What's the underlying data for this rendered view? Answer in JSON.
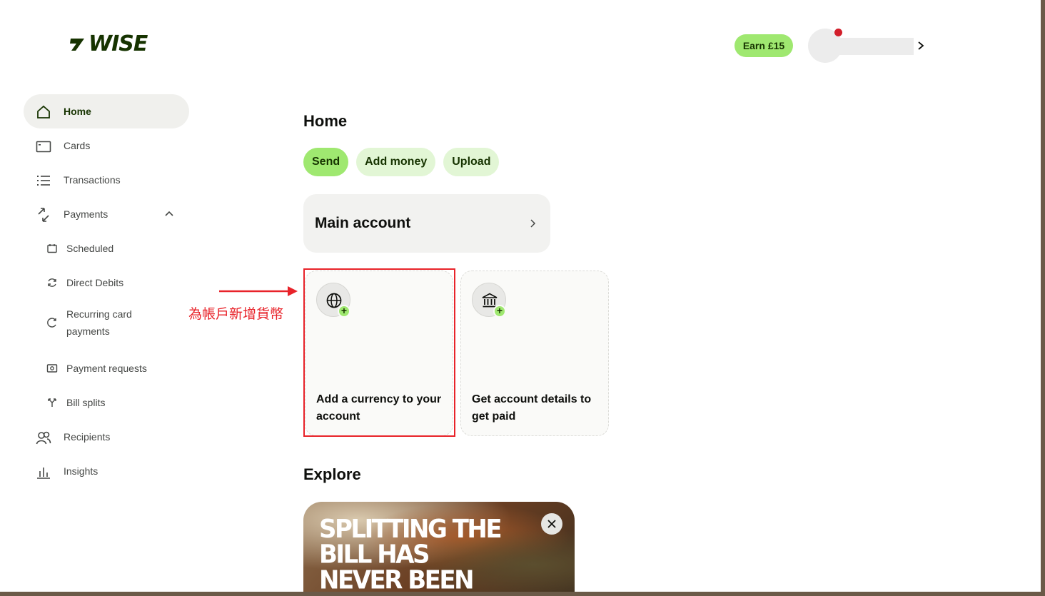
{
  "brand": {
    "logo_text": "WISE",
    "accent": "#9fe870",
    "dark": "#163300"
  },
  "header": {
    "earn_label": "Earn £15"
  },
  "sidebar": {
    "items": [
      {
        "label": "Home",
        "icon": "home-icon",
        "active": true
      },
      {
        "label": "Cards",
        "icon": "card-icon"
      },
      {
        "label": "Transactions",
        "icon": "list-icon"
      },
      {
        "label": "Payments",
        "icon": "payments-icon",
        "expanded": true
      },
      {
        "label": "Scheduled",
        "icon": "calendar-icon"
      },
      {
        "label": "Direct Debits",
        "icon": "refresh-icon"
      },
      {
        "label": "Recurring card payments",
        "icon": "recurring-icon"
      },
      {
        "label": "Payment requests",
        "icon": "request-icon"
      },
      {
        "label": "Bill splits",
        "icon": "split-icon"
      },
      {
        "label": "Recipients",
        "icon": "recipients-icon"
      },
      {
        "label": "Insights",
        "icon": "chart-icon"
      }
    ]
  },
  "main": {
    "title": "Home",
    "actions": [
      "Send",
      "Add money",
      "Upload"
    ],
    "main_account": "Main account",
    "tiles": [
      {
        "label": "Add a currency to your account",
        "icon": "globe-icon"
      },
      {
        "label": "Get account details to get paid",
        "icon": "bank-icon"
      }
    ],
    "annotation": "為帳戶新增貨幣",
    "explore_title": "Explore",
    "banner_text": "SPLITTING THE BILL HAS NEVER BEEN SO EASY"
  }
}
